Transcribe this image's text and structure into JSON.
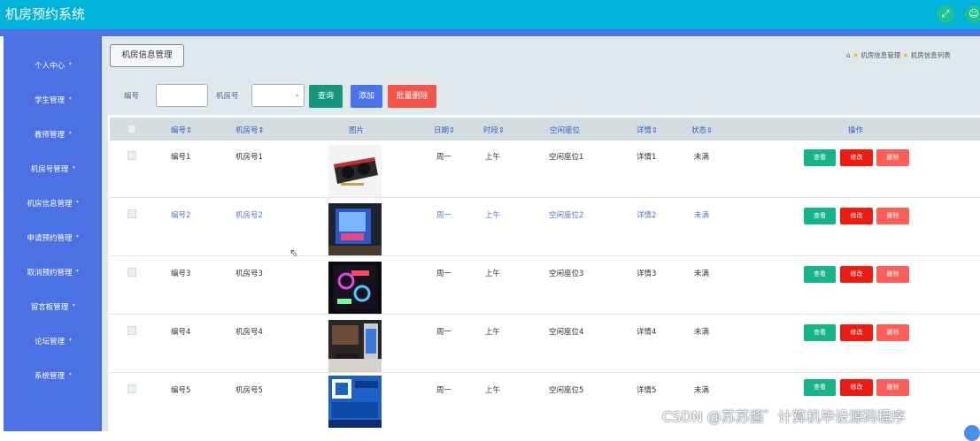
{
  "app": {
    "title": "机房预约系统"
  },
  "topbar": {
    "expand_icon": "fullscreen-icon",
    "user_icon": "user-icon",
    "accent": "#00b3d8"
  },
  "sidebar": {
    "items": [
      {
        "label": "个人中心"
      },
      {
        "label": "学生管理"
      },
      {
        "label": "教师管理"
      },
      {
        "label": "机房号管理"
      },
      {
        "label": "机房信息管理"
      },
      {
        "label": "申请预约管理"
      },
      {
        "label": "取消预约管理"
      },
      {
        "label": "留言板管理"
      },
      {
        "label": "论坛管理"
      },
      {
        "label": "系统管理"
      }
    ],
    "color": "#4b71e4"
  },
  "page_tag": "机房信息管理",
  "breadcrumb": {
    "home_icon": "home-icon",
    "items": [
      "机房信息管理",
      "机房信息列表"
    ]
  },
  "filters": {
    "number_label": "编号",
    "number_value": "",
    "room_label": "机房号",
    "room_value": "",
    "search_button": "查询",
    "add_button": "添加",
    "bulk_delete_button": "批量删除"
  },
  "table": {
    "columns": [
      "编号",
      "机房号",
      "图片",
      "日期",
      "时段",
      "空闲座位",
      "详情",
      "状态",
      "操作"
    ],
    "rows": [
      {
        "number": "编号1",
        "room": "机房号1",
        "date": "周一",
        "period": "上午",
        "seat": "空闲座位1",
        "detail": "详情1",
        "status": "未满",
        "image": "graphics-card-photo"
      },
      {
        "number": "编号2",
        "room": "机房号2",
        "date": "周一",
        "period": "上午",
        "seat": "空闲座位2",
        "detail": "详情2",
        "status": "未满",
        "image": "lit-pc-case-photo"
      },
      {
        "number": "编号3",
        "room": "机房号3",
        "date": "周一",
        "period": "上午",
        "seat": "空闲座位3",
        "detail": "详情3",
        "status": "未满",
        "image": "rgb-pc-case-photo"
      },
      {
        "number": "编号4",
        "room": "机房号4",
        "date": "周一",
        "period": "上午",
        "seat": "空闲座位4",
        "detail": "详情4",
        "status": "未满",
        "image": "desktop-setup-photo"
      },
      {
        "number": "编号5",
        "room": "机房号5",
        "date": "周一",
        "period": "上午",
        "seat": "空闲座位5",
        "detail": "详情5",
        "status": "未满",
        "image": "cpu-box-photo"
      }
    ],
    "action_view": "查看",
    "action_edit": "修改",
    "action_delete": "删除"
  },
  "watermark": "CSDN @苏苏酱゛计算机毕设源码程序"
}
